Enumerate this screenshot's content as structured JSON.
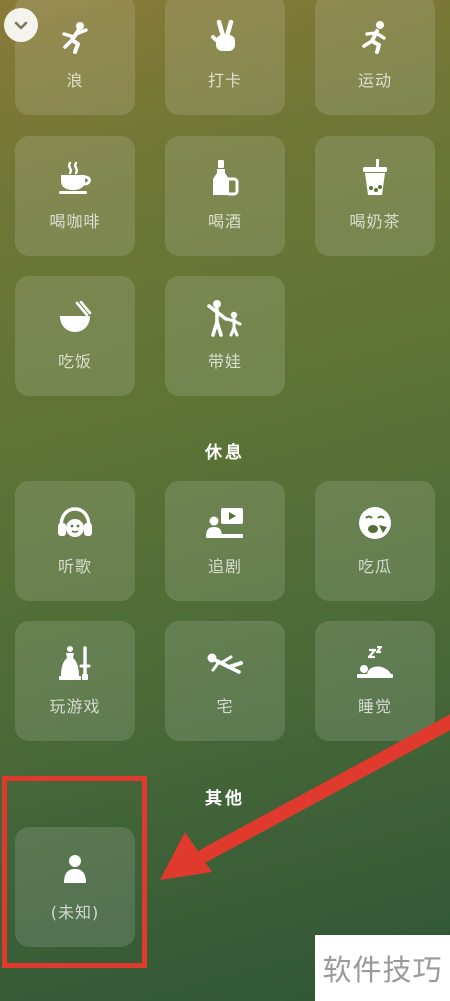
{
  "colors": {
    "accent_red": "#e03a2e",
    "tile_icon": "#ffffff",
    "label": "rgba(255,255,255,0.72)"
  },
  "top_button": {
    "icon": "chevron-down-icon"
  },
  "activity_tiles": [
    {
      "label": "浪",
      "icon": "dancing-person-icon"
    },
    {
      "label": "打卡",
      "icon": "victory-hand-icon"
    },
    {
      "label": "运动",
      "icon": "running-person-icon"
    },
    {
      "label": "喝咖啡",
      "icon": "coffee-cup-icon"
    },
    {
      "label": "喝酒",
      "icon": "wine-bottle-icon"
    },
    {
      "label": "喝奶茶",
      "icon": "bubble-tea-icon"
    },
    {
      "label": "吃饭",
      "icon": "rice-bowl-icon"
    },
    {
      "label": "带娃",
      "icon": "parent-child-icon"
    }
  ],
  "rest_section": {
    "title": "休息",
    "tiles": [
      {
        "label": "听歌",
        "icon": "headphones-icon"
      },
      {
        "label": "追剧",
        "icon": "tv-viewer-icon"
      },
      {
        "label": "吃瓜",
        "icon": "eating-face-icon"
      },
      {
        "label": "玩游戏",
        "icon": "game-pieces-icon"
      },
      {
        "label": "宅",
        "icon": "lying-person-icon"
      },
      {
        "label": "睡觉",
        "icon": "sleep-icon"
      }
    ]
  },
  "other_section": {
    "title": "其他",
    "tiles": [
      {
        "label": "(未知)",
        "icon": "person-icon"
      }
    ]
  },
  "watermark": {
    "text": "软件技巧"
  }
}
